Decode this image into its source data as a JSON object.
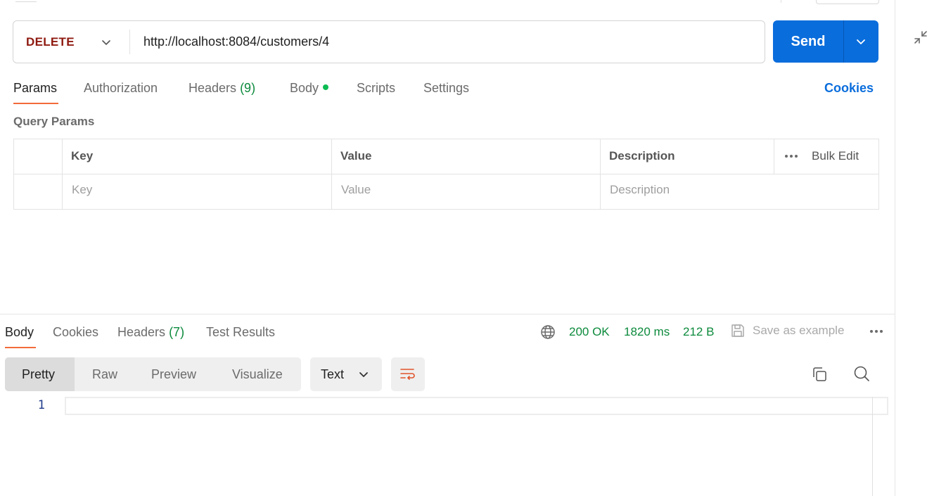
{
  "request": {
    "method": "DELETE",
    "url": "http://localhost:8084/customers/4",
    "send_label": "Send",
    "method_color": "#8e1a10",
    "send_color": "#0a6ddc"
  },
  "request_tabs": {
    "params": "Params",
    "authorization": "Authorization",
    "headers": "Headers",
    "headers_count": "(9)",
    "body": "Body",
    "scripts": "Scripts",
    "settings": "Settings",
    "active": "Params"
  },
  "cookies_link": "Cookies",
  "query_params": {
    "title": "Query Params",
    "columns": [
      "Key",
      "Value",
      "Description"
    ],
    "placeholders": [
      "Key",
      "Value",
      "Description"
    ],
    "bulk_edit": "Bulk Edit"
  },
  "response_tabs": {
    "body": "Body",
    "cookies": "Cookies",
    "headers": "Headers",
    "headers_count": "(7)",
    "test_results": "Test Results",
    "active": "Body"
  },
  "response_meta": {
    "status": "200 OK",
    "time": "1820 ms",
    "size": "212 B",
    "save_as_example": "Save as example",
    "status_color": "#0c8a3c"
  },
  "view_modes": {
    "pretty": "Pretty",
    "raw": "Raw",
    "preview": "Preview",
    "visualize": "Visualize",
    "active": "Pretty"
  },
  "format": "Text",
  "editor": {
    "line_numbers": [
      "1"
    ]
  },
  "icons": [
    "collapse-icon",
    "chevron-down-icon",
    "globe-icon",
    "save-icon",
    "more-icon",
    "wrap-lines-icon",
    "copy-icon",
    "search-icon"
  ]
}
